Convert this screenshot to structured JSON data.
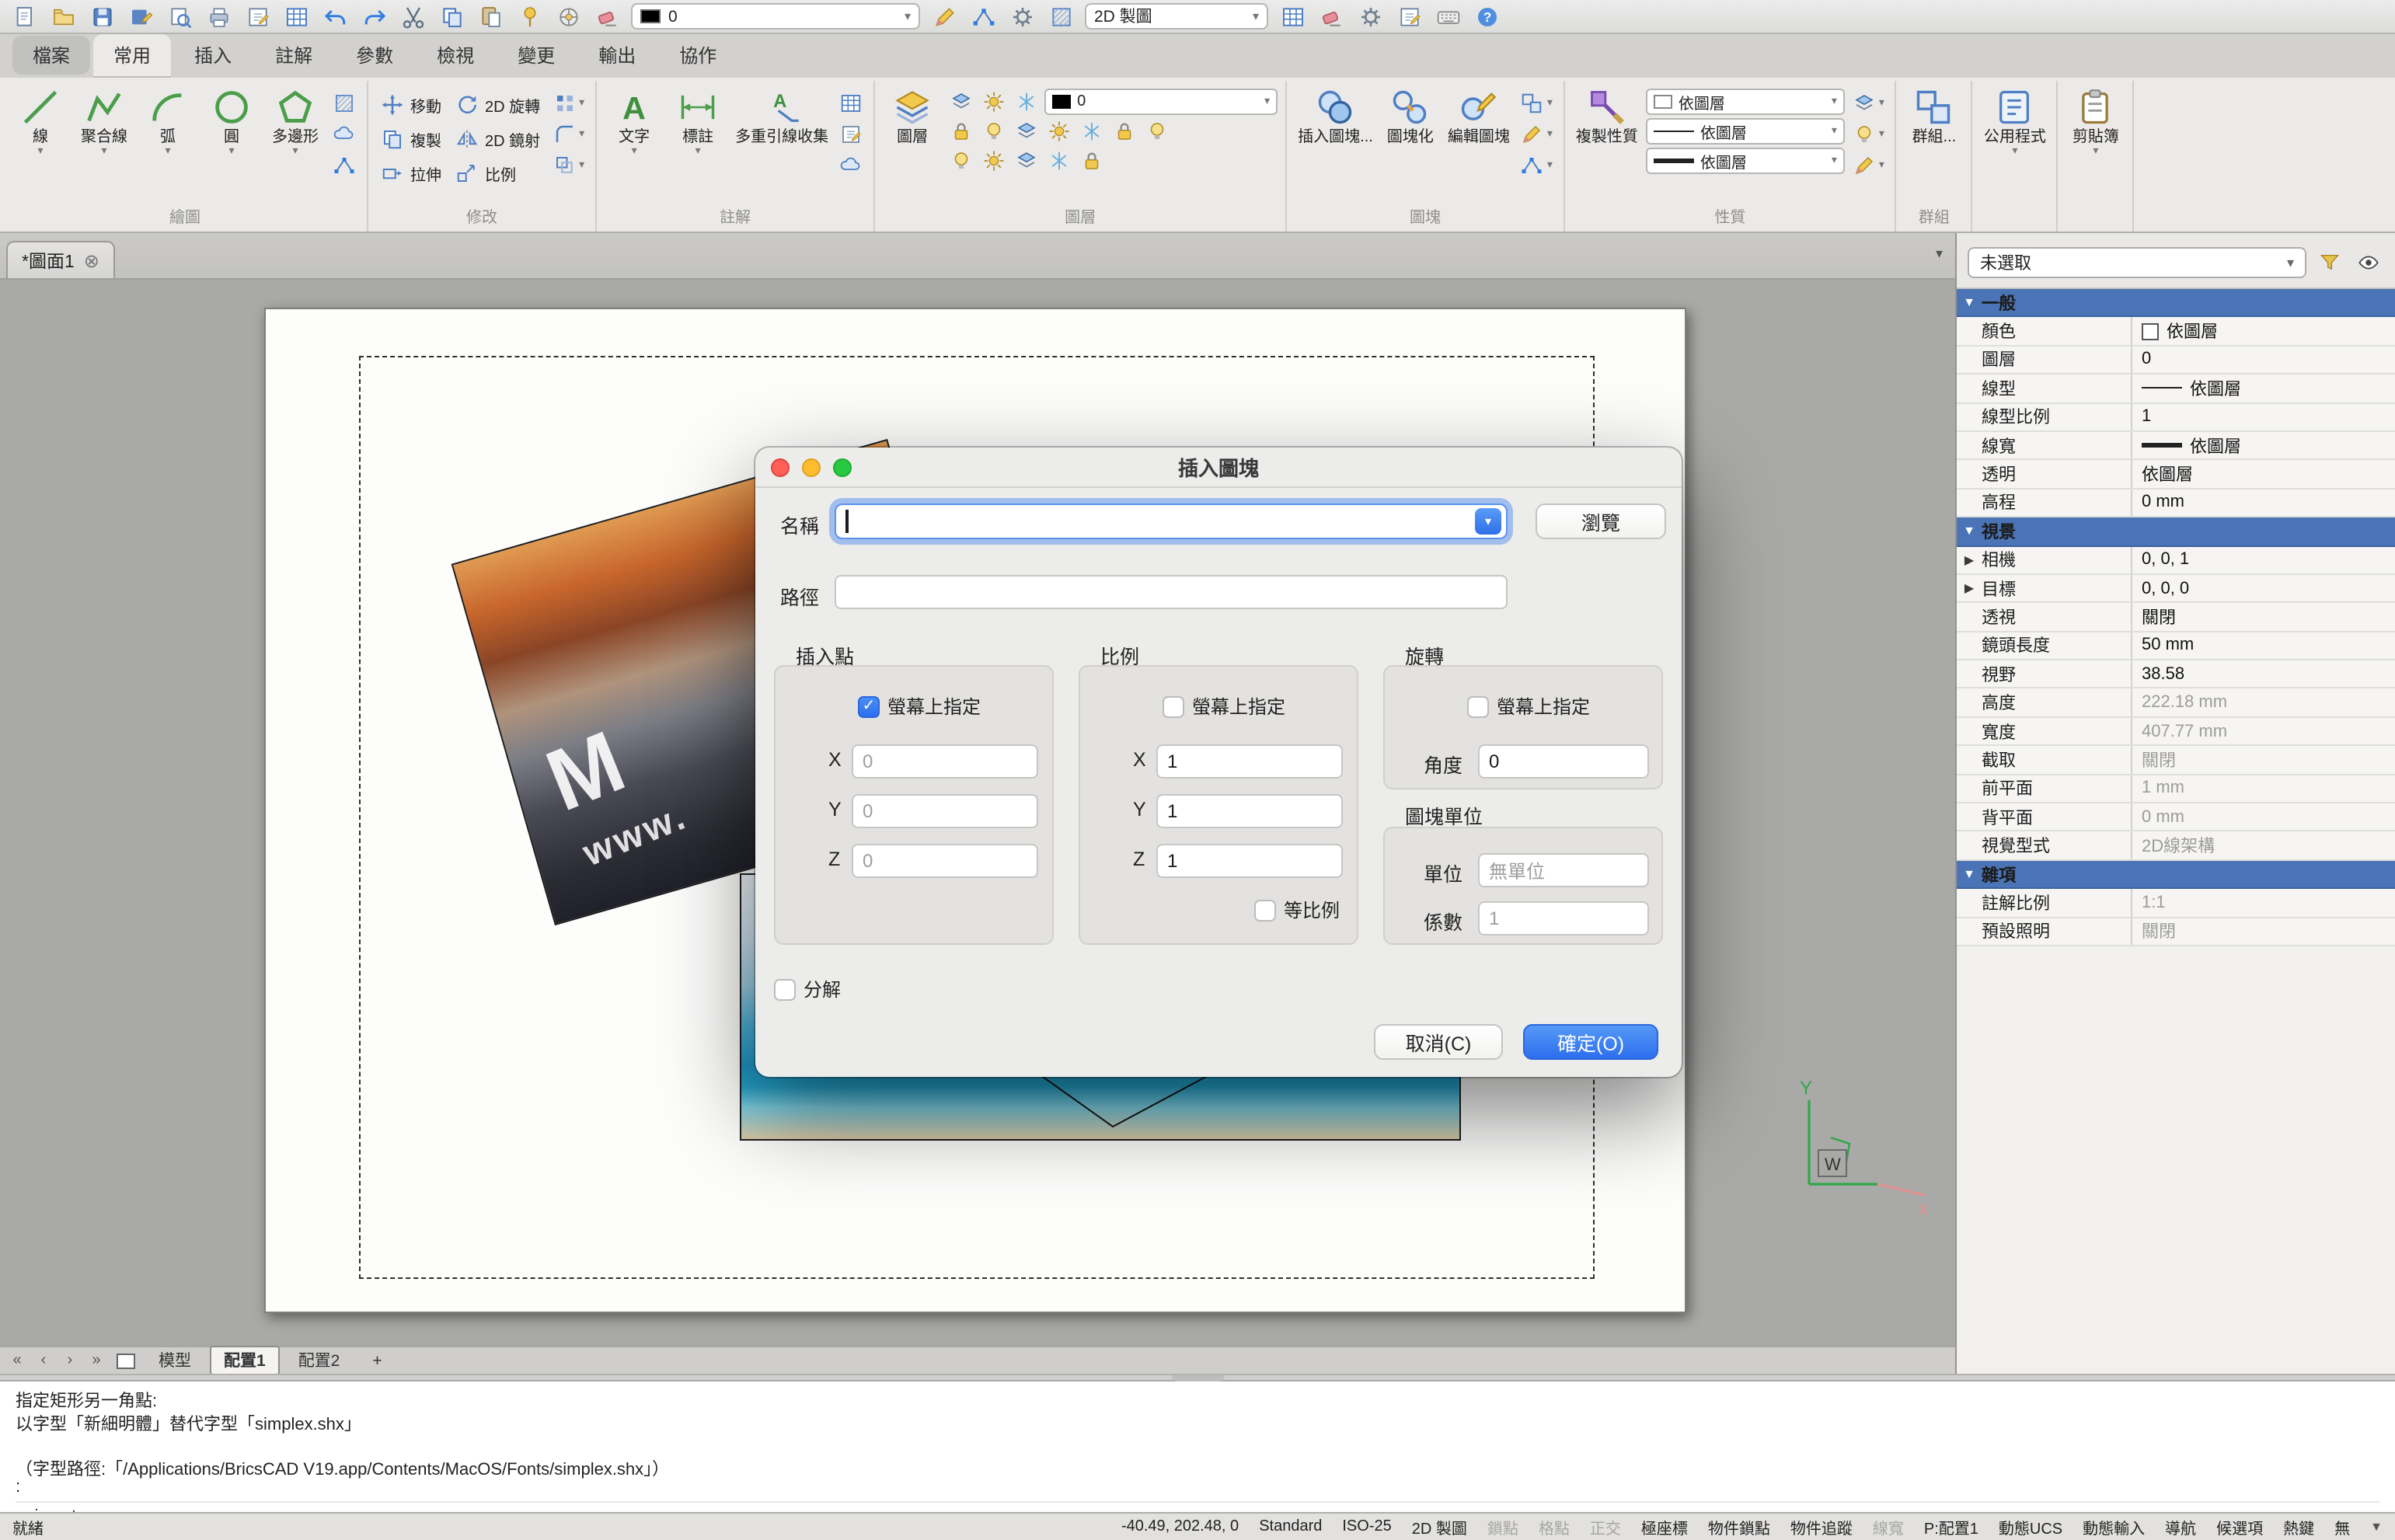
{
  "quick_toolbar": {
    "items": [
      {
        "kind": "icon",
        "name": "new",
        "icon": "new"
      },
      {
        "kind": "icon",
        "name": "open",
        "icon": "open"
      },
      {
        "kind": "icon",
        "name": "save",
        "icon": "save"
      },
      {
        "kind": "icon",
        "name": "save-as",
        "icon": "saveas"
      },
      {
        "kind": "icon",
        "name": "print-preview",
        "icon": "preview"
      },
      {
        "kind": "icon",
        "name": "plot",
        "icon": "plot"
      },
      {
        "kind": "icon",
        "name": "export",
        "icon": "note"
      },
      {
        "kind": "icon",
        "name": "publish",
        "icon": "table"
      },
      {
        "kind": "icon",
        "name": "undo",
        "icon": "undo"
      },
      {
        "kind": "icon",
        "name": "redo",
        "icon": "redo"
      },
      {
        "kind": "icon",
        "name": "cut",
        "icon": "cut"
      },
      {
        "kind": "icon",
        "name": "copy-clip",
        "icon": "copy"
      },
      {
        "kind": "icon",
        "name": "paste",
        "icon": "paste"
      },
      {
        "kind": "icon",
        "name": "point-marker",
        "icon": "pin"
      },
      {
        "kind": "icon",
        "name": "snap-settings",
        "icon": "wheel"
      },
      {
        "kind": "icon",
        "name": "erase",
        "icon": "eraser"
      },
      {
        "kind": "combo",
        "name": "entity-color",
        "value": "0",
        "swatch": "#000000",
        "width": 186
      },
      {
        "kind": "icon",
        "name": "draw-order",
        "icon": "pencil"
      },
      {
        "kind": "icon",
        "name": "polyline-edit",
        "icon": "nodes"
      },
      {
        "kind": "icon",
        "name": "ucs-settings",
        "icon": "gear"
      },
      {
        "kind": "icon",
        "name": "hatch-tool",
        "icon": "hatch"
      },
      {
        "kind": "combo",
        "name": "workspace",
        "value": "2D 製圖",
        "width": 118
      },
      {
        "kind": "icon",
        "name": "sheet-table",
        "icon": "table"
      },
      {
        "kind": "icon",
        "name": "clean",
        "icon": "eraser"
      },
      {
        "kind": "icon",
        "name": "settings",
        "icon": "gear"
      },
      {
        "kind": "icon",
        "name": "edit-note",
        "icon": "note"
      },
      {
        "kind": "icon",
        "name": "shortcuts",
        "icon": "keyboard"
      },
      {
        "kind": "icon",
        "name": "help",
        "icon": "help"
      }
    ]
  },
  "ribbon": {
    "tabs": [
      {
        "label": "檔案",
        "kind": "file"
      },
      {
        "label": "常用",
        "active": true
      },
      {
        "label": "插入"
      },
      {
        "label": "註解"
      },
      {
        "label": "參數"
      },
      {
        "label": "檢視"
      },
      {
        "label": "變更"
      },
      {
        "label": "輸出"
      },
      {
        "label": "協作"
      }
    ],
    "groups": [
      {
        "id": "draw",
        "label": "繪圖",
        "items": [
          {
            "type": "big",
            "name": "line",
            "icon": "line",
            "label": "線",
            "arrow": true
          },
          {
            "type": "big",
            "name": "polyline",
            "icon": "polyline",
            "label": "聚合線",
            "arrow": true
          },
          {
            "type": "big",
            "name": "arc",
            "icon": "arc",
            "label": "弧",
            "arrow": true
          },
          {
            "type": "big",
            "name": "circle",
            "icon": "circle",
            "label": "圓",
            "arrow": true
          },
          {
            "type": "big",
            "name": "polygon",
            "icon": "polygon",
            "label": "多邊形",
            "arrow": true
          },
          {
            "type": "stack",
            "icons": [
              "hatch",
              "cloud",
              "nodes"
            ]
          }
        ]
      },
      {
        "id": "modify",
        "label": "修改",
        "items": [
          {
            "type": "col",
            "entries": [
              {
                "name": "move",
                "icon": "move",
                "label": "移動"
              },
              {
                "name": "copy",
                "icon": "copy",
                "label": "複製"
              },
              {
                "name": "stretch",
                "icon": "stretch",
                "label": "拉伸"
              }
            ]
          },
          {
            "type": "col",
            "entries": [
              {
                "name": "rotate-2d",
                "icon": "rotate",
                "label": "2D 旋轉"
              },
              {
                "name": "mirror-2d",
                "icon": "mirror",
                "label": "2D 鏡射"
              },
              {
                "name": "scale",
                "icon": "scale",
                "label": "比例"
              }
            ]
          },
          {
            "type": "stack",
            "icons": [
              "array",
              "fillet",
              "offset"
            ],
            "arrows": true
          }
        ]
      },
      {
        "id": "annotate",
        "label": "註解",
        "items": [
          {
            "type": "big",
            "name": "text",
            "icon": "text",
            "label": "文字",
            "arrow": true
          },
          {
            "type": "big",
            "name": "dimension",
            "icon": "dim",
            "label": "標註",
            "arrow": true
          },
          {
            "type": "big",
            "name": "mleader-collect",
            "icon": "mleader",
            "label": "多重引線收集"
          },
          {
            "type": "stack",
            "icons": [
              "table",
              "note",
              "cloud"
            ]
          }
        ]
      },
      {
        "id": "layers",
        "label": "圖層",
        "items": [
          {
            "type": "big",
            "name": "layers",
            "icon": "layers",
            "label": "圖層"
          },
          {
            "type": "layerblock",
            "combo": "0",
            "rows": [
              [
                "layerset",
                "sun",
                "freeze"
              ],
              [
                "lock",
                "bulb",
                "layerset",
                "sun",
                "freeze",
                "lock",
                "bulb"
              ],
              [
                "bulb",
                "sun",
                "layerset",
                "freeze",
                "lock"
              ]
            ]
          }
        ]
      },
      {
        "id": "blocks",
        "label": "圖塊",
        "items": [
          {
            "type": "big",
            "name": "insert-block",
            "icon": "insertblock",
            "label": "插入圖塊..."
          },
          {
            "type": "big",
            "name": "blockify",
            "icon": "blockify",
            "label": "圖塊化"
          },
          {
            "type": "big",
            "name": "edit-block",
            "icon": "editblock",
            "label": "編輯圖塊"
          },
          {
            "type": "stack",
            "icons": [
              "group",
              "pencil",
              "nodes"
            ],
            "arrows": true
          }
        ]
      },
      {
        "id": "properties",
        "label": "性質",
        "items": [
          {
            "type": "big",
            "name": "match-properties",
            "icon": "matchprops",
            "label": "複製性質"
          },
          {
            "type": "propcombos",
            "values": [
              "依圖層",
              "依圖層",
              "依圖層"
            ],
            "kinds": [
              "color",
              "line",
              "wline"
            ]
          },
          {
            "type": "stack",
            "icons": [
              "layerset",
              "bulb",
              "pencil"
            ],
            "arrows": true
          }
        ]
      },
      {
        "id": "groups",
        "label": "群組",
        "items": [
          {
            "type": "big",
            "name": "group",
            "icon": "group",
            "label": "群組..."
          }
        ]
      },
      {
        "id": "utilities",
        "label": "",
        "items": [
          {
            "type": "big",
            "name": "utilities",
            "icon": "utilities",
            "label": "公用程式",
            "arrow": true
          }
        ]
      },
      {
        "id": "clipboard",
        "label": "",
        "items": [
          {
            "type": "big",
            "name": "clipboard",
            "icon": "clipboard",
            "label": "剪貼簿",
            "arrow": true
          }
        ]
      }
    ]
  },
  "drawing": {
    "tab_label": "*圖面1",
    "watermark_m": "M",
    "watermark_www": "www.",
    "ucs_y": "Y",
    "ucs_w": "W",
    "ucs_x": "X"
  },
  "layout_tabs": {
    "items": [
      {
        "label": "模型",
        "active": false
      },
      {
        "label": "配置1",
        "active": true
      },
      {
        "label": "配置2",
        "active": false
      },
      {
        "label": "+",
        "active": false
      }
    ]
  },
  "dialog": {
    "title": "插入圖塊",
    "name_label": "名稱",
    "name_value": "",
    "browse_label": "瀏覽",
    "path_label": "路徑",
    "path_value": "",
    "insertion": {
      "title": "插入點",
      "specify_label": "螢幕上指定",
      "specify_checked": true,
      "fields": [
        {
          "label": "X",
          "value": "0"
        },
        {
          "label": "Y",
          "value": "0"
        },
        {
          "label": "Z",
          "value": "0"
        }
      ]
    },
    "scale": {
      "title": "比例",
      "specify_label": "螢幕上指定",
      "specify_checked": false,
      "fields": [
        {
          "label": "X",
          "value": "1"
        },
        {
          "label": "Y",
          "value": "1"
        },
        {
          "label": "Z",
          "value": "1"
        }
      ],
      "uniform_label": "等比例",
      "uniform_checked": false
    },
    "rotation": {
      "title": "旋轉",
      "specify_label": "螢幕上指定",
      "specify_checked": false,
      "angle_label": "角度",
      "angle_value": "0"
    },
    "block_unit": {
      "title": "圖塊單位",
      "unit_label": "單位",
      "unit_value": "無單位",
      "factor_label": "係數",
      "factor_value": "1"
    },
    "explode_label": "分解",
    "explode_checked": false,
    "cancel_label": "取消(C)",
    "ok_label": "確定(O)"
  },
  "properties": {
    "selector": "未選取",
    "sections": [
      {
        "title": "一般",
        "rows": [
          {
            "label": "顏色",
            "value": "依圖層",
            "swatch": "color"
          },
          {
            "label": "圖層",
            "value": "0"
          },
          {
            "label": "線型",
            "value": "依圖層",
            "swatch": "line"
          },
          {
            "label": "線型比例",
            "value": "1"
          },
          {
            "label": "線寬",
            "value": "依圖層",
            "swatch": "wline"
          },
          {
            "label": "透明",
            "value": "依圖層"
          },
          {
            "label": "高程",
            "value": "0 mm"
          }
        ]
      },
      {
        "title": "視景",
        "rows": [
          {
            "label": "相機",
            "value": "0, 0, 1",
            "expander": true
          },
          {
            "label": "目標",
            "value": "0, 0, 0",
            "expander": true
          },
          {
            "label": "透視",
            "value": "關閉"
          },
          {
            "label": "鏡頭長度",
            "value": "50 mm"
          },
          {
            "label": "視野",
            "value": "38.58"
          },
          {
            "label": "高度",
            "value": "222.18 mm",
            "dim": true
          },
          {
            "label": "寬度",
            "value": "407.77 mm",
            "dim": true
          },
          {
            "label": "截取",
            "value": "關閉",
            "dim": true
          },
          {
            "label": "前平面",
            "value": "1 mm",
            "dim": true
          },
          {
            "label": "背平面",
            "value": "0 mm",
            "dim": true
          },
          {
            "label": "視覺型式",
            "value": "2D線架構",
            "dim": true
          }
        ]
      },
      {
        "title": "雜項",
        "rows": [
          {
            "label": "註解比例",
            "value": "1:1",
            "dim": true
          },
          {
            "label": "預設照明",
            "value": "關閉",
            "dim": true
          }
        ]
      }
    ]
  },
  "command": {
    "lines": [
      "指定矩形另一角點:",
      "以字型「新細明體」替代字型「simplex.shx」",
      "",
      "（字型路徑:「/Applications/BricsCAD V19.app/Contents/MacOS/Fonts/simplex.shx」）",
      ":"
    ],
    "prompt": ": _insert"
  },
  "status_bar": {
    "ready": "就緒",
    "coordinates": "-40.49, 202.48, 0",
    "text_style": "Standard",
    "dim_style": "ISO-25",
    "workspace": "2D 製圖",
    "toggles": [
      {
        "label": "鎖點",
        "on": false
      },
      {
        "label": "格點",
        "on": false
      },
      {
        "label": "正交",
        "on": false
      },
      {
        "label": "極座標",
        "on": true
      },
      {
        "label": "物件鎖點",
        "on": true
      },
      {
        "label": "物件追蹤",
        "on": true
      },
      {
        "label": "線寬",
        "on": false
      },
      {
        "label": "P:配置1",
        "on": true
      },
      {
        "label": "動態UCS",
        "on": true
      },
      {
        "label": "動態輸入",
        "on": true
      },
      {
        "label": "導航",
        "on": true
      },
      {
        "label": "候選項",
        "on": true
      },
      {
        "label": "熱鍵",
        "on": true
      },
      {
        "label": "無",
        "on": true
      }
    ]
  },
  "colors": {
    "accent_blue": "#2d6fee",
    "section_header_blue": "#4a74b6",
    "canvas_gray": "#a9a9a7",
    "checked_blue": "#2d6fee"
  }
}
